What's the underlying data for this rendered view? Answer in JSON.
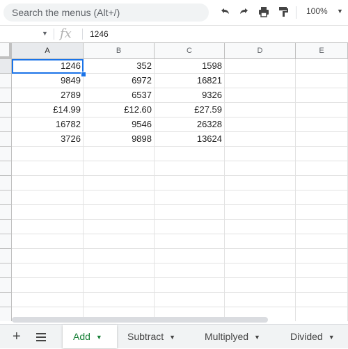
{
  "toolbar": {
    "search_placeholder": "Search the menus (Alt+/)",
    "undo_icon": "undo-icon",
    "redo_icon": "redo-icon",
    "print_icon": "print-icon",
    "paint_format_icon": "paint-format-icon",
    "zoom": "100%"
  },
  "formula_bar": {
    "fx_label": "fx",
    "value": "1246"
  },
  "columns": [
    "A",
    "B",
    "C",
    "D",
    "E"
  ],
  "rows": [
    [
      "1246",
      "352",
      "1598"
    ],
    [
      "9849",
      "6972",
      "16821"
    ],
    [
      "2789",
      "6537",
      "9326"
    ],
    [
      "£14.99",
      "£12.60",
      "£27.59"
    ],
    [
      "16782",
      "9546",
      "26328"
    ],
    [
      "3726",
      "9898",
      "13624"
    ]
  ],
  "sheets": [
    {
      "label": "Add",
      "active": true
    },
    {
      "label": "Subtract",
      "active": false
    },
    {
      "label": "Multiplyed",
      "active": false
    },
    {
      "label": "Divided",
      "active": false
    }
  ],
  "colors": {
    "accent": "#1a73e8",
    "active_tab_text": "#188038"
  }
}
